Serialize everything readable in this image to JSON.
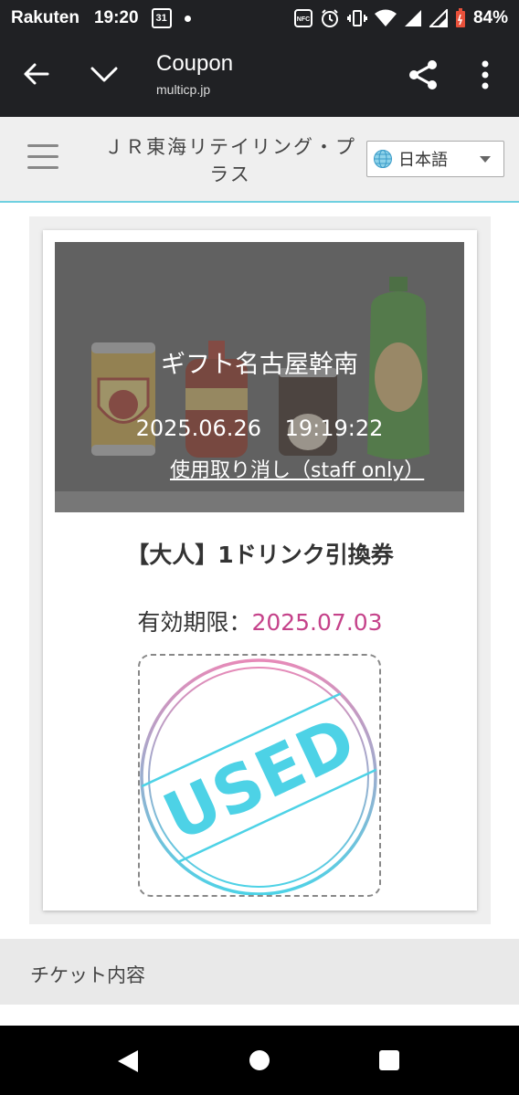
{
  "status_bar": {
    "carrier": "Rakuten",
    "time": "19:20",
    "calendar_day": "31",
    "battery": "84%"
  },
  "app_bar": {
    "title": "Coupon",
    "url": "multicp.jp"
  },
  "site": {
    "title": "ＪＲ東海リテイリング・プラス",
    "language": "日本語"
  },
  "coupon": {
    "store": "ギフト名古屋幹南",
    "used_date": "2025.06.26",
    "used_time": "19:19:22",
    "cancel_link": "使用取り消し（staff only）",
    "product_name": "【大人】1ドリンク引換券",
    "expiry_label": "有効期限：",
    "expiry_date": "2025.07.03",
    "stamp_text": "USED"
  },
  "sections": {
    "ticket_details": "チケット内容"
  },
  "colors": {
    "expiry_accent": "#c5428a",
    "stamp_cyan": "#4dd2e6",
    "stamp_pink": "#e68ab8",
    "header_border": "#6fd0e0"
  }
}
